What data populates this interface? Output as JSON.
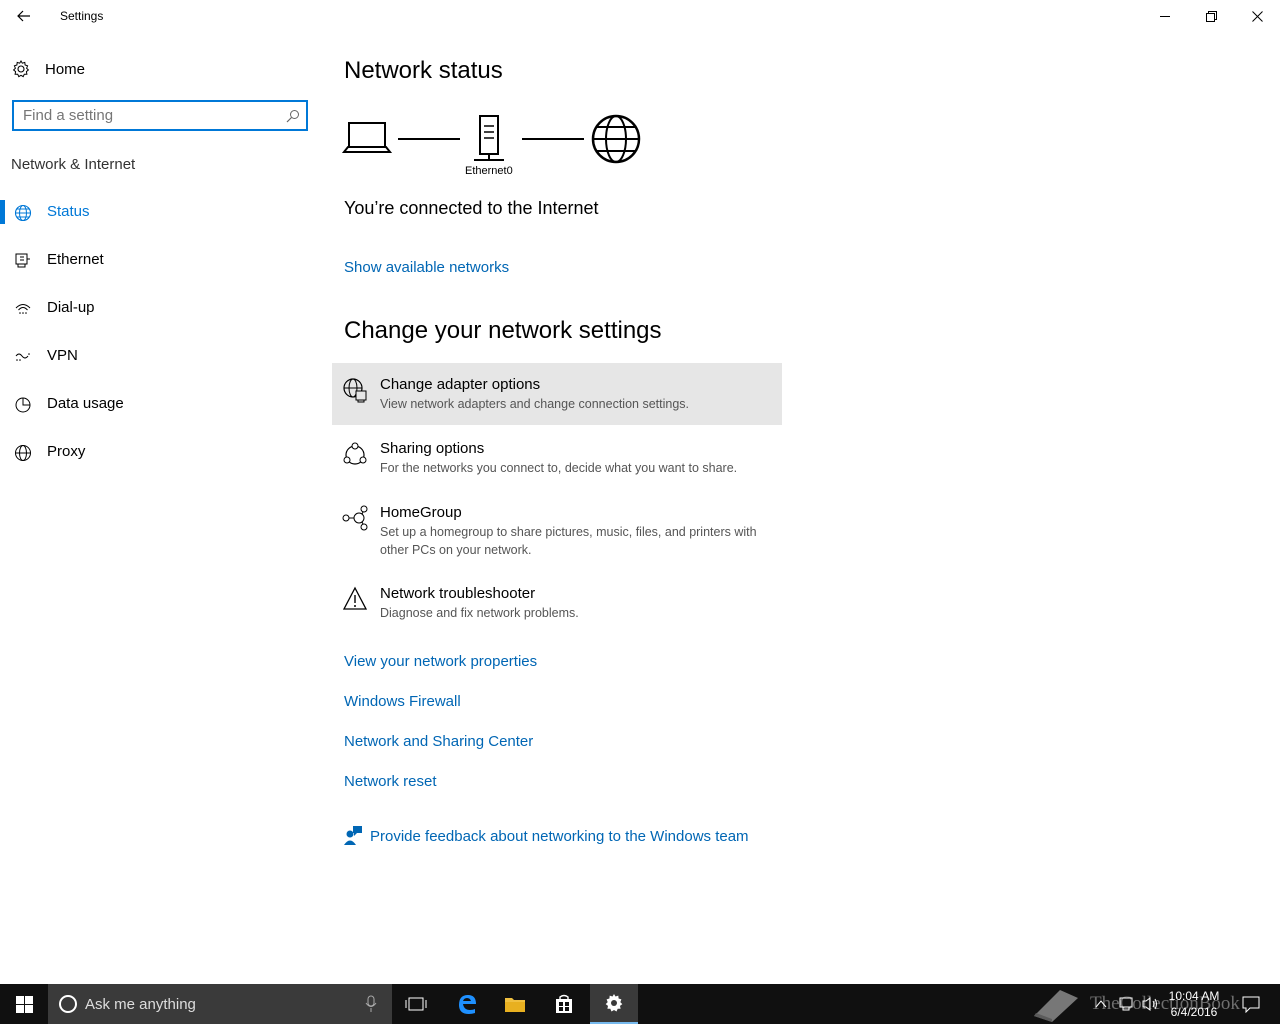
{
  "window": {
    "title": "Settings",
    "controls": [
      "minimize",
      "restore",
      "close"
    ]
  },
  "sidebar": {
    "home_label": "Home",
    "search_placeholder": "Find a setting",
    "section_title": "Network & Internet",
    "items": [
      {
        "label": "Status",
        "icon": "globe-status-icon",
        "active": true
      },
      {
        "label": "Ethernet",
        "icon": "ethernet-icon",
        "active": false
      },
      {
        "label": "Dial-up",
        "icon": "dialup-icon",
        "active": false
      },
      {
        "label": "VPN",
        "icon": "vpn-icon",
        "active": false
      },
      {
        "label": "Data usage",
        "icon": "data-usage-icon",
        "active": false
      },
      {
        "label": "Proxy",
        "icon": "proxy-globe-icon",
        "active": false
      }
    ]
  },
  "main": {
    "status_heading": "Network status",
    "diagram_caption": "Ethernet0",
    "connected_text": "You’re connected to the Internet",
    "show_networks_link": "Show available networks",
    "change_heading": "Change your network settings",
    "options": [
      {
        "title": "Change adapter options",
        "desc": "View network adapters and change connection settings.",
        "icon": "adapter-globe-icon",
        "highlighted": true
      },
      {
        "title": "Sharing options",
        "desc": "For the networks you connect to, decide what you want to share.",
        "icon": "sharing-icon",
        "highlighted": false
      },
      {
        "title": "HomeGroup",
        "desc": "Set up a homegroup to share pictures, music, files, and printers with other PCs on your network.",
        "icon": "homegroup-icon",
        "highlighted": false
      },
      {
        "title": "Network troubleshooter",
        "desc": "Diagnose and fix network problems.",
        "icon": "warning-icon",
        "highlighted": false
      }
    ],
    "links": [
      "View your network properties",
      "Windows Firewall",
      "Network and Sharing Center",
      "Network reset"
    ],
    "feedback_link": "Provide feedback about networking to the Windows team"
  },
  "taskbar": {
    "search_placeholder": "Ask me anything",
    "time": "10:04 AM",
    "date": "6/4/2016",
    "watermark": "TheCollectionBook",
    "accent_color": "#0078d7"
  }
}
